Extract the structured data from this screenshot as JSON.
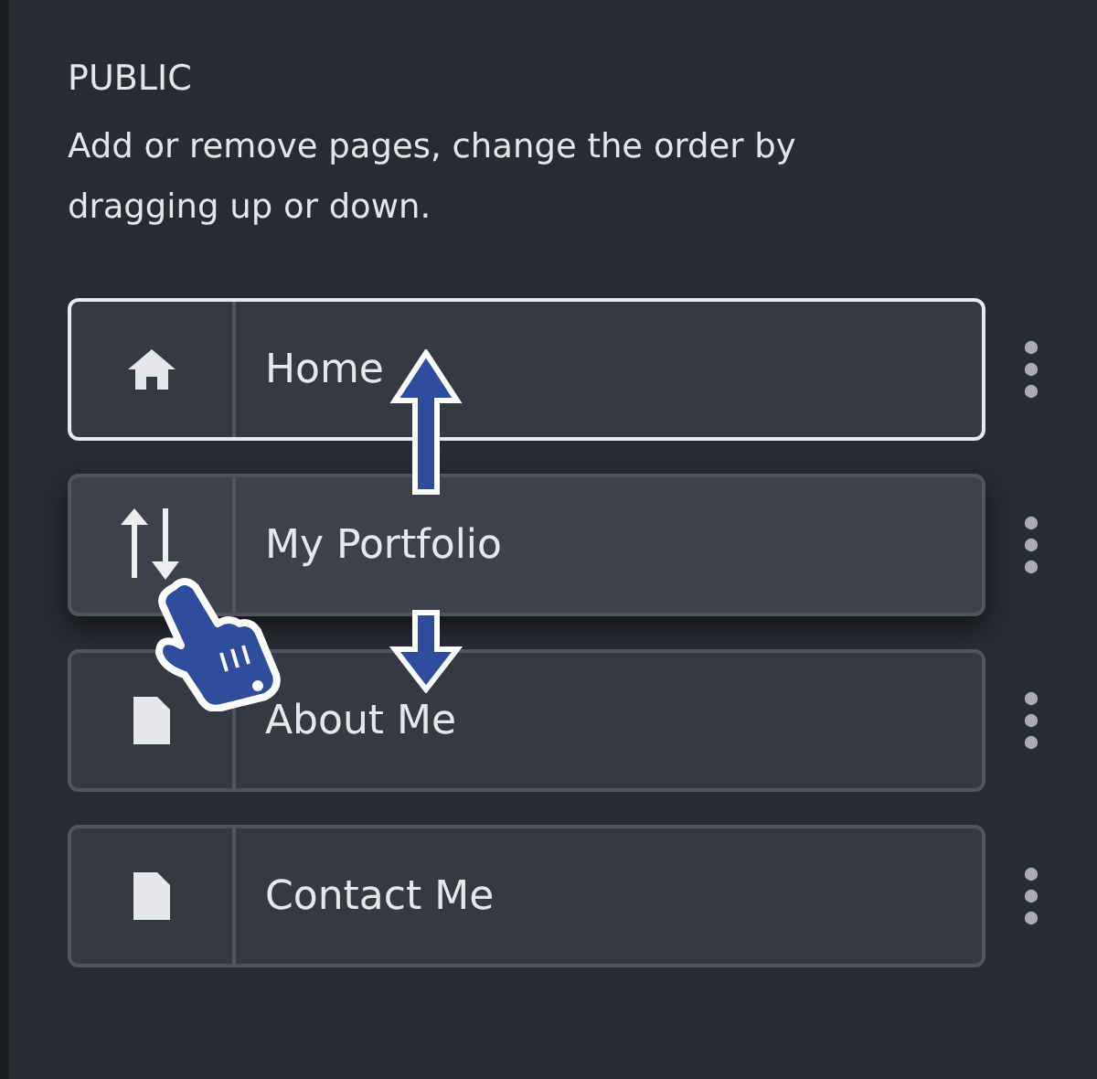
{
  "section": {
    "title": "PUBLIC",
    "description": "Add or remove pages, change the order by dragging up or down."
  },
  "pages": [
    {
      "label": "Home",
      "kind": "home",
      "selected": true,
      "dragging": false
    },
    {
      "label": "My Portfolio",
      "kind": "sort",
      "selected": false,
      "dragging": true
    },
    {
      "label": "About Me",
      "kind": "page",
      "selected": false,
      "dragging": false
    },
    {
      "label": "Contact Me",
      "kind": "page",
      "selected": false,
      "dragging": false
    }
  ]
}
